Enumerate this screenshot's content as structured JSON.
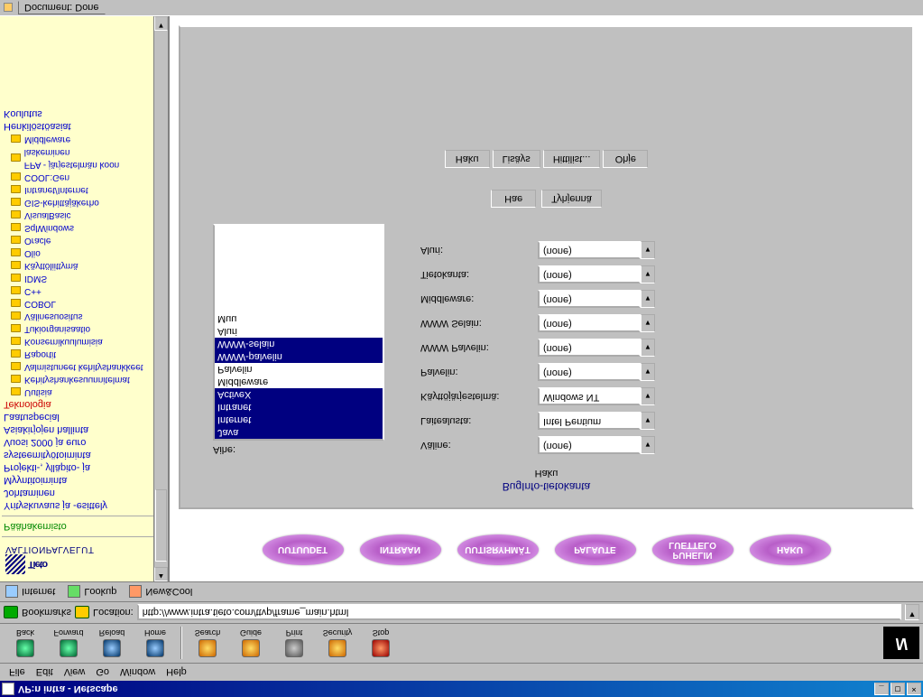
{
  "window": {
    "title": "VP:n intra - Netscape"
  },
  "menu": [
    "File",
    "Edit",
    "View",
    "Go",
    "Window",
    "Help"
  ],
  "toolbar": {
    "back": "Back",
    "forward": "Forward",
    "reload": "Reload",
    "home": "Home",
    "search": "Search",
    "guide": "Guide",
    "print": "Print",
    "security": "Security",
    "stop": "Stop"
  },
  "location": {
    "bookmarks": "Bookmarks",
    "label": "Location:",
    "url": "http://www.intra.tieto.com/ttvp/frame_main.html"
  },
  "toolbar2": {
    "internet": "Internet",
    "lookup": "Lookup",
    "newcool": "New&Cool"
  },
  "sidebar": {
    "logo": "Tieto",
    "logo_sub": "VALTIONPALVELUT",
    "root": "Päähakemisto",
    "items": [
      "Yrityskuvaus ja -esittely",
      "Johtaminen",
      "Myyntitoiminta",
      "Projekti-, ylläpito- ja systeemityötoiminta",
      "Vuosi 2000 ja euro",
      "Asiakirjojen hallinta",
      "Laatuspecial"
    ],
    "tech": "Teknologia",
    "subitems": [
      "Uutisia",
      "Kehityshankesuunnitelmat",
      "Valmistuneet kehityshankkeet",
      "Raportit",
      "Konsernikuulumisia",
      "Tukiorganisaatio",
      "Välinesuositus",
      "COBOL",
      "C++",
      "IDMS",
      "Käyttöliittymä",
      "Olio",
      "Oracle",
      "SqlWindows",
      "VisualBasic",
      "GIS-kehittäjäkerho",
      "Intranet/Internet",
      "COOL:Gen",
      "FPA - järjestelmän koon laskeminen",
      "Middleware"
    ],
    "after": [
      "Henkilöstöasiat",
      "Koulutus"
    ]
  },
  "pills": [
    "UUTUUDET",
    "INTRAAN",
    "UUTISRYHMÄT",
    "PALAUTE",
    "PUHELIN LUETTELO",
    "HAKU"
  ],
  "panel": {
    "title": "BugInfo-tietokanta",
    "subtitle": "Haku",
    "aihe_label": "Aihe:",
    "list": [
      "Java",
      "Internet",
      "Intranet",
      "ActiveX",
      "Middleware",
      "Palvelin",
      "WWW-palvelin",
      "WWW-selain",
      "Aluri",
      "Muu"
    ],
    "selected": [
      "Java",
      "Internet",
      "Intranet",
      "ActiveX",
      "WWW-palvelin",
      "WWW-selain"
    ],
    "fields": [
      {
        "label": "Väline:",
        "value": "(none)"
      },
      {
        "label": "Laitealusta:",
        "value": "Intel Pentium"
      },
      {
        "label": "Käyttöjärjestelmä:",
        "value": "Windows NT"
      },
      {
        "label": "Palvelin:",
        "value": "(none)"
      },
      {
        "label": "WWW Palvelin:",
        "value": "(none)"
      },
      {
        "label": "WWW Selain:",
        "value": "(none)"
      },
      {
        "label": "Middleware:",
        "value": "(none)"
      },
      {
        "label": "Tietokanta:",
        "value": "(none)"
      },
      {
        "label": "Aluri:",
        "value": "(none)"
      }
    ],
    "actions": {
      "hae": "Hae",
      "tyhjenna": "Tyhjennä"
    },
    "tabs": {
      "haku": "Haku",
      "lisays": "Lisäys",
      "hittilista": "Hittilist...",
      "ohje": "Ohje"
    }
  },
  "status": {
    "doc": "Document: Done"
  }
}
